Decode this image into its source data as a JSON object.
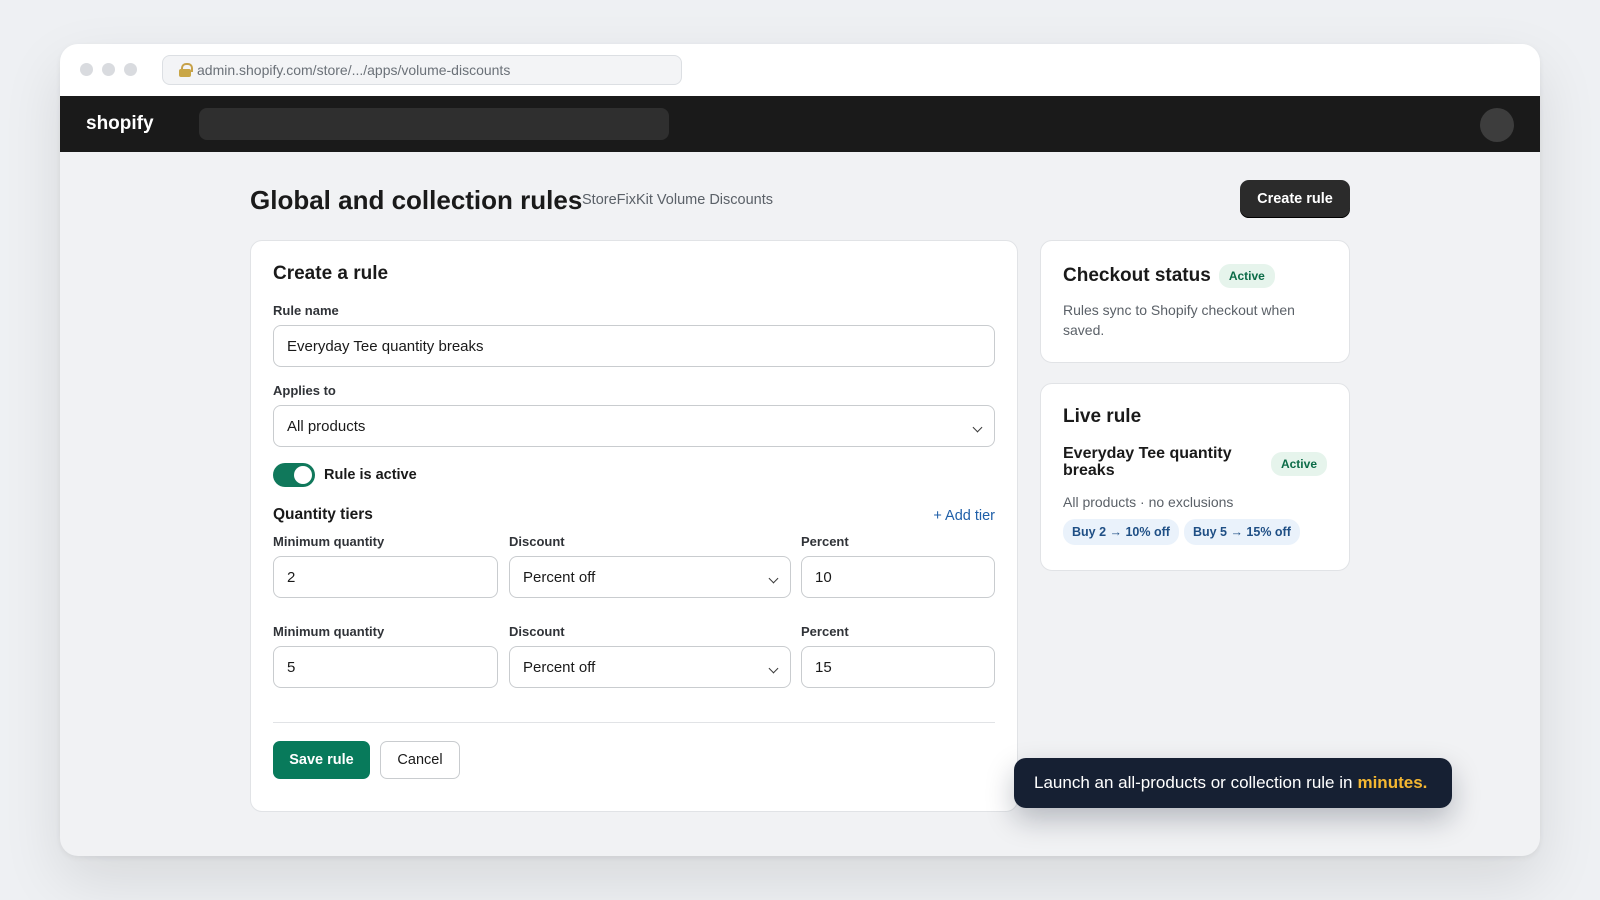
{
  "browser": {
    "url": "admin.shopify.com/store/.../apps/volume-discounts"
  },
  "topbar": {
    "logo": "shopify"
  },
  "header": {
    "title": "Global and collection rules",
    "subtitle": "StoreFixKit Volume Discounts",
    "create_button": "Create rule"
  },
  "form": {
    "title": "Create a rule",
    "rule_name_label": "Rule name",
    "rule_name_value": "Everyday Tee quantity breaks",
    "applies_to_label": "Applies to",
    "applies_to_value": "All products",
    "active": true,
    "active_label": "Rule is active",
    "tiers_title": "Quantity tiers",
    "add_tier": "+ Add tier",
    "tiers": [
      {
        "min_label": "Minimum quantity",
        "min_value": "2",
        "discount_label": "Discount",
        "discount_value": "Percent off",
        "percent_label": "Percent",
        "percent_value": "10"
      },
      {
        "min_label": "Minimum quantity",
        "min_value": "5",
        "discount_label": "Discount",
        "discount_value": "Percent off",
        "percent_label": "Percent",
        "percent_value": "15"
      }
    ],
    "save_button": "Save rule",
    "cancel_button": "Cancel"
  },
  "checkout_status": {
    "title": "Checkout status",
    "badge": "Active",
    "description": "Rules sync to Shopify checkout when saved."
  },
  "live_rule": {
    "title": "Live rule",
    "rule_name": "Everyday Tee quantity breaks",
    "badge": "Active",
    "scope": "All products · no exclusions",
    "chips": [
      "Buy 2 → 10% off",
      "Buy 5 → 15% off"
    ]
  },
  "toast": {
    "text": "Launch an all-products or collection rule in",
    "highlight": "minutes."
  },
  "colors": {
    "primary_green": "#087a5b",
    "topbar": "#1a1a1a",
    "toast_bg": "#162033",
    "toast_highlight": "#f5b731",
    "link_blue": "#1f5fa8"
  }
}
